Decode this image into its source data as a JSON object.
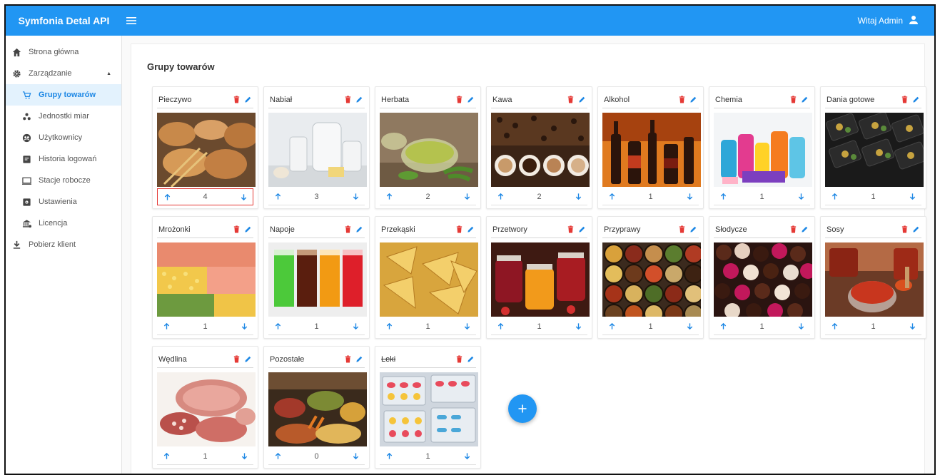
{
  "app": {
    "title": "Symfonia Detal API"
  },
  "header": {
    "greeting": "Witaj Admin"
  },
  "sidebar": {
    "items": [
      {
        "label": "Strona główna",
        "icon": "home-icon"
      },
      {
        "label": "Zarządzanie",
        "icon": "gear-icon",
        "expanded": true
      },
      {
        "label": "Grupy towarów",
        "icon": "cart-icon",
        "active": true
      },
      {
        "label": "Jednostki miar",
        "icon": "units-icon"
      },
      {
        "label": "Użytkownicy",
        "icon": "users-icon"
      },
      {
        "label": "Historia logowań",
        "icon": "history-icon"
      },
      {
        "label": "Stacje robocze",
        "icon": "monitor-icon"
      },
      {
        "label": "Ustawienia",
        "icon": "settings-icon"
      },
      {
        "label": "Licencja",
        "icon": "license-icon"
      },
      {
        "label": "Pobierz klient",
        "icon": "download-icon"
      }
    ]
  },
  "main": {
    "title": "Grupy towarów",
    "groups": [
      {
        "name": "Pieczywo",
        "count": "4",
        "highlighted": true,
        "struck": false,
        "image": "bread"
      },
      {
        "name": "Nabiał",
        "count": "3",
        "highlighted": false,
        "struck": false,
        "image": "dairy"
      },
      {
        "name": "Herbata",
        "count": "2",
        "highlighted": false,
        "struck": false,
        "image": "tea"
      },
      {
        "name": "Kawa",
        "count": "2",
        "highlighted": false,
        "struck": false,
        "image": "coffee"
      },
      {
        "name": "Alkohol",
        "count": "1",
        "highlighted": false,
        "struck": false,
        "image": "alcohol"
      },
      {
        "name": "Chemia",
        "count": "1",
        "highlighted": false,
        "struck": false,
        "image": "chemicals"
      },
      {
        "name": "Dania gotowe",
        "count": "1",
        "highlighted": false,
        "struck": false,
        "image": "ready-meals"
      },
      {
        "name": "Mrożonki",
        "count": "1",
        "highlighted": false,
        "struck": false,
        "image": "frozen"
      },
      {
        "name": "Napoje",
        "count": "1",
        "highlighted": false,
        "struck": false,
        "image": "drinks"
      },
      {
        "name": "Przekąski",
        "count": "1",
        "highlighted": false,
        "struck": false,
        "image": "snacks"
      },
      {
        "name": "Przetwory",
        "count": "1",
        "highlighted": false,
        "struck": false,
        "image": "preserves"
      },
      {
        "name": "Przyprawy",
        "count": "1",
        "highlighted": false,
        "struck": false,
        "image": "spices"
      },
      {
        "name": "Słodycze",
        "count": "1",
        "highlighted": false,
        "struck": false,
        "image": "sweets"
      },
      {
        "name": "Sosy",
        "count": "1",
        "highlighted": false,
        "struck": false,
        "image": "sauces"
      },
      {
        "name": "Wędlina",
        "count": "1",
        "highlighted": false,
        "struck": false,
        "image": "cold-cuts"
      },
      {
        "name": "Pozostałe",
        "count": "0",
        "highlighted": false,
        "struck": false,
        "image": "other"
      },
      {
        "name": "Leki",
        "count": "1",
        "highlighted": false,
        "struck": true,
        "image": "medicine"
      }
    ]
  },
  "colors": {
    "primary": "#2196f3",
    "delete": "#e53935",
    "edit": "#1e88e5",
    "active_bg": "#e3f2fd",
    "highlight": "#e53935"
  }
}
